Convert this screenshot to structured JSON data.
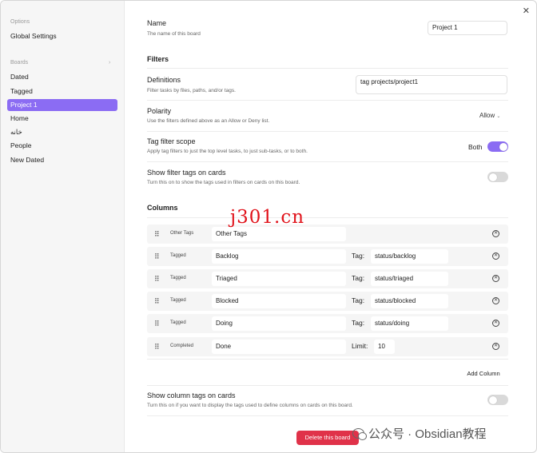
{
  "sidebar": {
    "options_label": "Options",
    "global_settings": "Global Settings",
    "boards_label": "Boards",
    "boards": [
      "Dated",
      "Tagged",
      "Project 1",
      "Home",
      "خانه",
      "People",
      "New Dated"
    ],
    "active_index": 2
  },
  "settings": {
    "name": {
      "title": "Name",
      "desc": "The name of this board",
      "value": "Project 1"
    },
    "filters_heading": "Filters",
    "definitions": {
      "title": "Definitions",
      "desc": "Filter tasks by files, paths, and/or tags.",
      "value": "tag  projects/project1"
    },
    "polarity": {
      "title": "Polarity",
      "desc": "Use the filters defined above as an Allow or Deny list.",
      "value": "Allow"
    },
    "tag_scope": {
      "title": "Tag filter scope",
      "desc": "Apply tag filters to just the top level tasks, to just sub-tasks, or to both.",
      "value": "Both",
      "on": true
    },
    "show_filter_tags": {
      "title": "Show filter tags on cards",
      "desc": "Turn this on to show the tags used in filters on cards on this board.",
      "on": false
    },
    "columns_heading": "Columns",
    "columns": [
      {
        "type": "Other Tags",
        "name": "Other Tags",
        "label": "",
        "value": ""
      },
      {
        "type": "Tagged",
        "name": "Backlog",
        "label": "Tag:",
        "value": "status/backlog"
      },
      {
        "type": "Tagged",
        "name": "Triaged",
        "label": "Tag:",
        "value": "status/triaged"
      },
      {
        "type": "Tagged",
        "name": "Blocked",
        "label": "Tag:",
        "value": "status/blocked"
      },
      {
        "type": "Tagged",
        "name": "Doing",
        "label": "Tag:",
        "value": "status/doing"
      },
      {
        "type": "Completed",
        "name": "Done",
        "label": "Limit:",
        "value": "10"
      }
    ],
    "add_column": "Add Column",
    "show_column_tags": {
      "title": "Show column tags on cards",
      "desc": "Turn this on if you want to display the tags used to define columns on cards on this board.",
      "on": false
    },
    "delete_board": "Delete this board"
  },
  "icons": {
    "close": "close-icon",
    "grip": "drag-handle-icon",
    "remove": "remove-circle-icon",
    "chevron": "chevron-down-icon"
  },
  "colors": {
    "accent": "#8b6cf3",
    "danger": "#e03249",
    "watermark": "#e1141c"
  },
  "watermark_text": "j301.cn",
  "footer_text": "公众号 · Obsidian教程"
}
